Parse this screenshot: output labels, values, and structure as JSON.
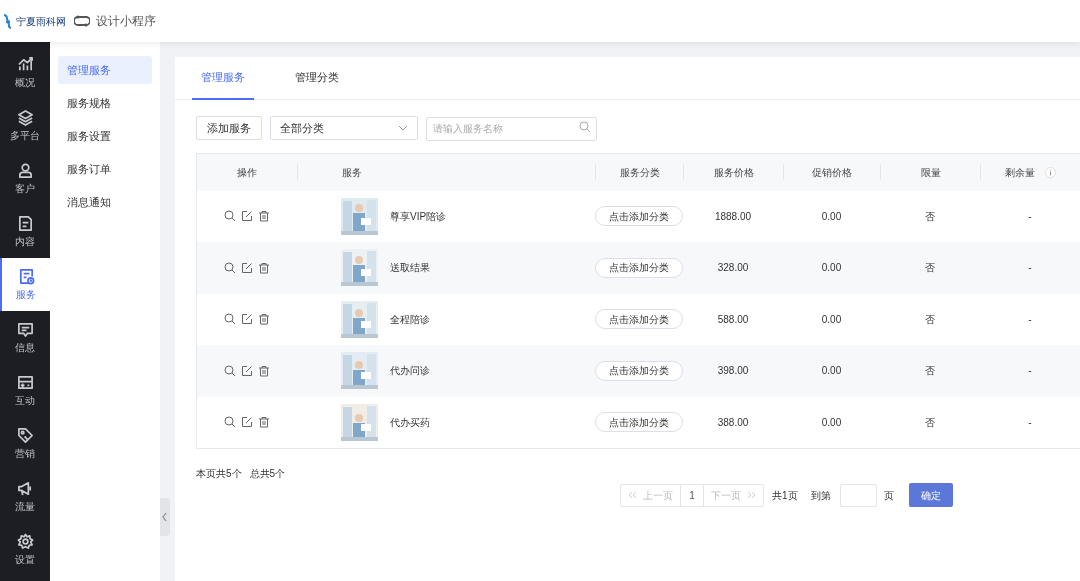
{
  "header": {
    "logo_text": "宁夏雨科网",
    "app_title": "设计小程序"
  },
  "nav": [
    {
      "label": "概况",
      "selected": false
    },
    {
      "label": "多平台",
      "selected": false
    },
    {
      "label": "客户",
      "selected": false
    },
    {
      "label": "内容",
      "selected": false
    },
    {
      "label": "服务",
      "selected": true
    },
    {
      "label": "信息",
      "selected": false
    },
    {
      "label": "互动",
      "selected": false
    },
    {
      "label": "营销",
      "selected": false
    },
    {
      "label": "流量",
      "selected": false
    },
    {
      "label": "设置",
      "selected": false
    }
  ],
  "submenu": [
    {
      "label": "管理服务",
      "selected": true
    },
    {
      "label": "服务规格",
      "selected": false
    },
    {
      "label": "服务设置",
      "selected": false
    },
    {
      "label": "服务订单",
      "selected": false
    },
    {
      "label": "消息通知",
      "selected": false
    }
  ],
  "tabs": [
    {
      "label": "管理服务",
      "selected": true
    },
    {
      "label": "管理分类",
      "selected": false
    }
  ],
  "toolbar": {
    "add_button": "添加服务",
    "category_select": "全部分类",
    "search": {
      "placeholder": "请输入服务名称"
    }
  },
  "table": {
    "columns": [
      "操作",
      "服务",
      "服务分类",
      "服务价格",
      "促销价格",
      "限量",
      "剩余量"
    ],
    "rows": [
      {
        "service": "尊享VIP陪诊",
        "category_button": "点击添加分类",
        "price": "1888.00",
        "promo_price": "0.00",
        "limited": "否",
        "remaining": "-"
      },
      {
        "service": "送取结果",
        "category_button": "点击添加分类",
        "price": "328.00",
        "promo_price": "0.00",
        "limited": "否",
        "remaining": "-"
      },
      {
        "service": "全程陪诊",
        "category_button": "点击添加分类",
        "price": "588.00",
        "promo_price": "0.00",
        "limited": "否",
        "remaining": "-"
      },
      {
        "service": "代办问诊",
        "category_button": "点击添加分类",
        "price": "398.00",
        "promo_price": "0.00",
        "limited": "否",
        "remaining": "-"
      },
      {
        "service": "代办买药",
        "category_button": "点击添加分类",
        "price": "388.00",
        "promo_price": "0.00",
        "limited": "否",
        "remaining": "-"
      }
    ]
  },
  "summary": {
    "page_count": "本页共5个",
    "total_count": "总共5个"
  },
  "pagination": {
    "prev": "上一页",
    "pages": [
      {
        "label": "1",
        "selected": false
      }
    ],
    "next": "下一页",
    "total_pages": "共1页",
    "goto_label": "到第",
    "goto_unit": "页",
    "confirm": "确定"
  }
}
